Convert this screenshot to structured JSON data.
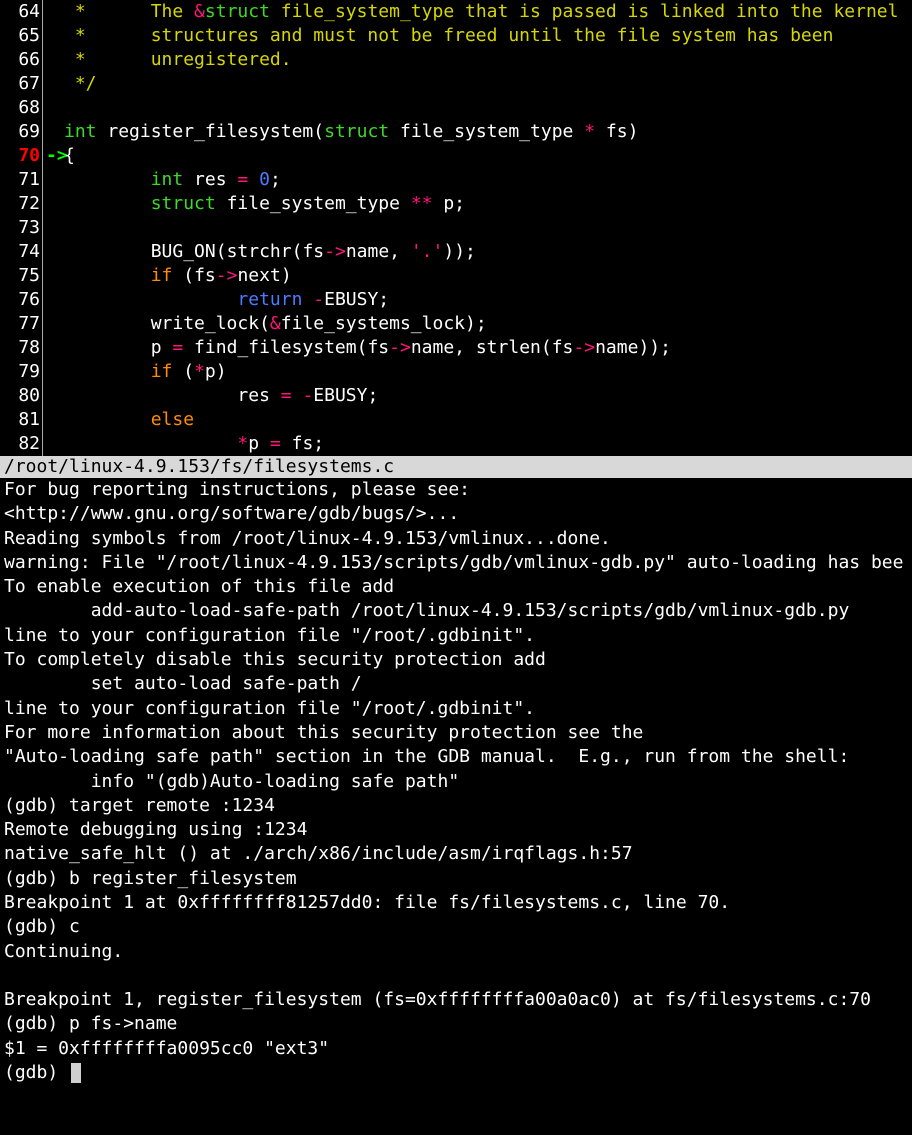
{
  "code": {
    "file_path": "/root/linux-4.9.153/fs/filesystems.c",
    "current_line": 70,
    "lines": [
      {
        "num": 64,
        "tokens": [
          [
            "comment",
            " *      The "
          ],
          [
            "op",
            "&"
          ],
          [
            "kw-type",
            "struct"
          ],
          [
            "comment",
            " file_system_type that is passed is linked into the kernel"
          ]
        ]
      },
      {
        "num": 65,
        "tokens": [
          [
            "comment",
            " *      structures and must not be freed until the file system has been"
          ]
        ]
      },
      {
        "num": 66,
        "tokens": [
          [
            "comment",
            " *      unregistered."
          ]
        ]
      },
      {
        "num": 67,
        "tokens": [
          [
            "comment",
            " */"
          ]
        ]
      },
      {
        "num": 68,
        "tokens": []
      },
      {
        "num": 69,
        "tokens": [
          [
            "kw-type",
            "int"
          ],
          [
            "ident",
            " register_filesystem"
          ],
          [
            "paren",
            "("
          ],
          [
            "kw-type",
            "struct"
          ],
          [
            "ident",
            " file_system_type "
          ],
          [
            "op",
            "*"
          ],
          [
            "ident",
            " fs"
          ],
          [
            "paren",
            ")"
          ]
        ]
      },
      {
        "num": 70,
        "arrow": "->",
        "tokens": [
          [
            "paren",
            "{"
          ]
        ]
      },
      {
        "num": 71,
        "tokens": [
          [
            "ident",
            "        "
          ],
          [
            "kw-type",
            "int"
          ],
          [
            "ident",
            " res "
          ],
          [
            "op",
            "="
          ],
          [
            "ident",
            " "
          ],
          [
            "num",
            "0"
          ],
          [
            "ident",
            ";"
          ]
        ]
      },
      {
        "num": 72,
        "tokens": [
          [
            "ident",
            "        "
          ],
          [
            "kw-type",
            "struct"
          ],
          [
            "ident",
            " file_system_type "
          ],
          [
            "op",
            "**"
          ],
          [
            "ident",
            " p;"
          ]
        ]
      },
      {
        "num": 73,
        "tokens": []
      },
      {
        "num": 74,
        "tokens": [
          [
            "ident",
            "        BUG_ON"
          ],
          [
            "paren",
            "("
          ],
          [
            "ident",
            "strchr"
          ],
          [
            "paren",
            "("
          ],
          [
            "ident",
            "fs"
          ],
          [
            "op",
            "->"
          ],
          [
            "ident",
            "name, "
          ],
          [
            "str",
            "'.'"
          ],
          [
            "paren",
            "))"
          ],
          [
            "ident",
            ";"
          ]
        ]
      },
      {
        "num": 75,
        "tokens": [
          [
            "ident",
            "        "
          ],
          [
            "kw-flow",
            "if"
          ],
          [
            "ident",
            " "
          ],
          [
            "paren",
            "("
          ],
          [
            "ident",
            "fs"
          ],
          [
            "op",
            "->"
          ],
          [
            "ident",
            "next"
          ],
          [
            "paren",
            ")"
          ]
        ]
      },
      {
        "num": 76,
        "tokens": [
          [
            "ident",
            "                "
          ],
          [
            "kw-ret",
            "return"
          ],
          [
            "ident",
            " "
          ],
          [
            "op",
            "-"
          ],
          [
            "ident",
            "EBUSY;"
          ]
        ]
      },
      {
        "num": 77,
        "tokens": [
          [
            "ident",
            "        write_lock"
          ],
          [
            "paren",
            "("
          ],
          [
            "op",
            "&"
          ],
          [
            "ident",
            "file_systems_lock"
          ],
          [
            "paren",
            ")"
          ],
          [
            "ident",
            ";"
          ]
        ]
      },
      {
        "num": 78,
        "tokens": [
          [
            "ident",
            "        p "
          ],
          [
            "op",
            "="
          ],
          [
            "ident",
            " find_filesystem"
          ],
          [
            "paren",
            "("
          ],
          [
            "ident",
            "fs"
          ],
          [
            "op",
            "->"
          ],
          [
            "ident",
            "name, strlen"
          ],
          [
            "paren",
            "("
          ],
          [
            "ident",
            "fs"
          ],
          [
            "op",
            "->"
          ],
          [
            "ident",
            "name"
          ],
          [
            "paren",
            "))"
          ],
          [
            "ident",
            ";"
          ]
        ]
      },
      {
        "num": 79,
        "tokens": [
          [
            "ident",
            "        "
          ],
          [
            "kw-flow",
            "if"
          ],
          [
            "ident",
            " "
          ],
          [
            "paren",
            "("
          ],
          [
            "op",
            "*"
          ],
          [
            "ident",
            "p"
          ],
          [
            "paren",
            ")"
          ]
        ]
      },
      {
        "num": 80,
        "tokens": [
          [
            "ident",
            "                res "
          ],
          [
            "op",
            "="
          ],
          [
            "ident",
            " "
          ],
          [
            "op",
            "-"
          ],
          [
            "ident",
            "EBUSY;"
          ]
        ]
      },
      {
        "num": 81,
        "tokens": [
          [
            "ident",
            "        "
          ],
          [
            "kw-flow",
            "else"
          ]
        ]
      },
      {
        "num": 82,
        "tokens": [
          [
            "ident",
            "                "
          ],
          [
            "op",
            "*"
          ],
          [
            "ident",
            "p "
          ],
          [
            "op",
            "="
          ],
          [
            "ident",
            " fs;"
          ]
        ]
      }
    ]
  },
  "terminal": {
    "prompt": "(gdb) ",
    "lines": [
      "For bug reporting instructions, please see:",
      "<http://www.gnu.org/software/gdb/bugs/>...",
      "Reading symbols from /root/linux-4.9.153/vmlinux...done.",
      "warning: File \"/root/linux-4.9.153/scripts/gdb/vmlinux-gdb.py\" auto-loading has bee",
      "To enable execution of this file add",
      "        add-auto-load-safe-path /root/linux-4.9.153/scripts/gdb/vmlinux-gdb.py",
      "line to your configuration file \"/root/.gdbinit\".",
      "To completely disable this security protection add",
      "        set auto-load safe-path /",
      "line to your configuration file \"/root/.gdbinit\".",
      "For more information about this security protection see the",
      "\"Auto-loading safe path\" section in the GDB manual.  E.g., run from the shell:",
      "        info \"(gdb)Auto-loading safe path\"",
      "(gdb) target remote :1234",
      "Remote debugging using :1234",
      "native_safe_hlt () at ./arch/x86/include/asm/irqflags.h:57",
      "(gdb) b register_filesystem",
      "Breakpoint 1 at 0xffffffff81257dd0: file fs/filesystems.c, line 70.",
      "(gdb) c",
      "Continuing.",
      "",
      "Breakpoint 1, register_filesystem (fs=0xffffffffa00a0ac0) at fs/filesystems.c:70",
      "(gdb) p fs->name",
      "$1 = 0xffffffffa0095cc0 \"ext3\""
    ],
    "current_prompt_text": "(gdb) "
  }
}
